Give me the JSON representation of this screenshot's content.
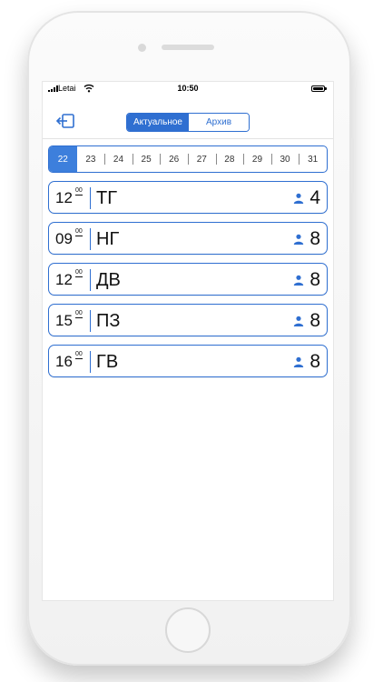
{
  "status_bar": {
    "carrier": "Letai",
    "time": "10:50",
    "icons": [
      "signal-bars-icon",
      "wifi-icon",
      "battery-icon"
    ]
  },
  "nav": {
    "exit_icon": "logout-icon",
    "tabs": [
      {
        "label": "Актуальное",
        "active": true
      },
      {
        "label": "Архив",
        "active": false
      }
    ]
  },
  "dates": [
    "22",
    "23",
    "24",
    "25",
    "26",
    "27",
    "28",
    "29",
    "30",
    "31"
  ],
  "selected_date": "22",
  "slots": [
    {
      "hour": "12",
      "minutes": "00",
      "code": "ТГ",
      "count": "4"
    },
    {
      "hour": "09",
      "minutes": "00",
      "code": "НГ",
      "count": "8"
    },
    {
      "hour": "12",
      "minutes": "00",
      "code": "ДВ",
      "count": "8"
    },
    {
      "hour": "15",
      "minutes": "00",
      "code": "ПЗ",
      "count": "8"
    },
    {
      "hour": "16",
      "minutes": "00",
      "code": "ГВ",
      "count": "8"
    }
  ],
  "colors": {
    "accent": "#2f6fd1",
    "selected_date_bg": "#3d7fdc",
    "person_icon": "#2f6fd1"
  }
}
